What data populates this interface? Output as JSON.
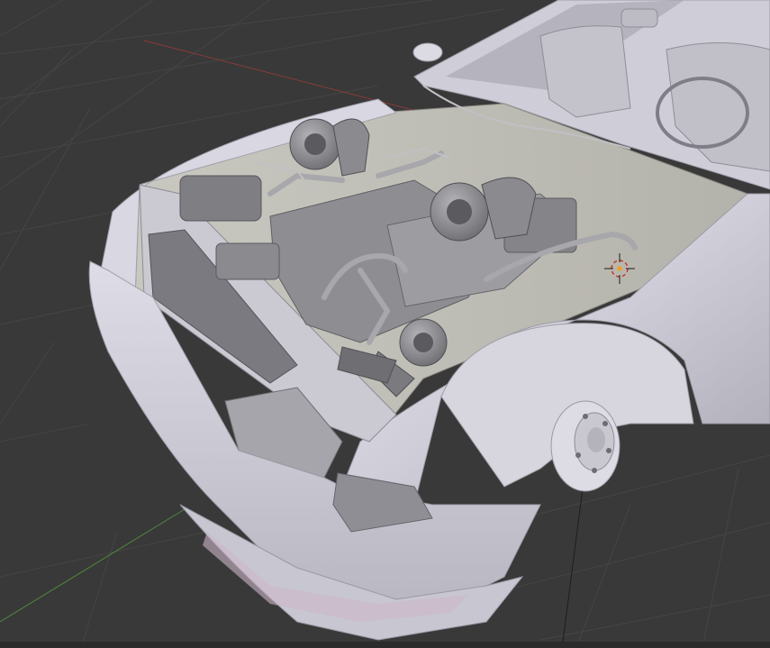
{
  "viewport": {
    "background": "#393939",
    "grid_line_color": "#454545",
    "x_axis_color": "#8a3a3a",
    "y_axis_color": "#4f8a3a",
    "model_color": "#d4d2dc",
    "model_shadow_color": "#8e8c96",
    "engine_color": "#9a9a9f",
    "cursor_icon": "3d-cursor-icon"
  }
}
